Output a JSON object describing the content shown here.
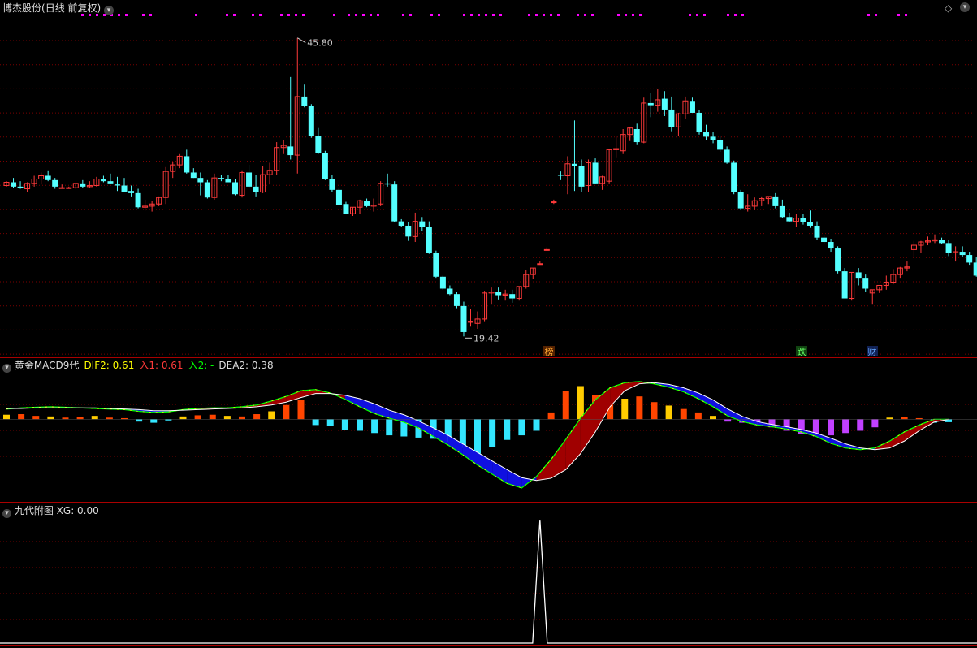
{
  "colors": {
    "up": "#ff3a3a",
    "down": "#54ffff",
    "grid": "#7a0000",
    "separator": "#aa0000",
    "magenta": "#ff00ff",
    "text": "#dddddd",
    "yellow": "#ffff00",
    "green": "#00ff00",
    "white": "#ffffff",
    "blue": "#1010e0",
    "darkred": "#a00000",
    "orange": "#ff4500",
    "gold": "#ffcc00",
    "purple": "#c040ff",
    "cyan": "#33e6ff"
  },
  "header": {
    "title": "博杰股份",
    "period": "(日线 前复权)",
    "dropdown_icon": "chevron-down-icon",
    "right_icon": "diamond-icon"
  },
  "chart_data": [
    {
      "type": "candlestick",
      "title": "博杰股份 (日线 前复权)",
      "ylim": [
        17.5,
        47.8
      ],
      "high_label": "45.80",
      "low_label": "19.42",
      "markers": [
        "榜",
        "跌",
        "财"
      ],
      "candles": [
        [
          32.2,
          32.6,
          32.1,
          32.5
        ],
        [
          32.5,
          32.9,
          32.0,
          32.1
        ],
        [
          32.1,
          32.6,
          31.9,
          32.0
        ],
        [
          31.9,
          32.5,
          31.6,
          32.4
        ],
        [
          32.4,
          33.1,
          32.1,
          32.8
        ],
        [
          32.8,
          33.4,
          32.3,
          33.1
        ],
        [
          33.1,
          33.6,
          32.6,
          32.7
        ],
        [
          32.7,
          32.9,
          31.9,
          32.1
        ],
        [
          32.0,
          32.3,
          31.9,
          32.0
        ],
        [
          32.0,
          32.1,
          31.9,
          32.0
        ],
        [
          32.0,
          32.4,
          31.9,
          32.4
        ],
        [
          32.4,
          32.7,
          32.0,
          32.1
        ],
        [
          32.1,
          32.6,
          32.0,
          32.2
        ],
        [
          32.2,
          33.0,
          32.1,
          32.8
        ],
        [
          32.8,
          33.1,
          32.5,
          32.6
        ],
        [
          32.6,
          33.3,
          32.4,
          32.4
        ],
        [
          32.3,
          33.0,
          31.7,
          32.2
        ],
        [
          32.2,
          32.9,
          31.8,
          31.6
        ],
        [
          31.7,
          32.2,
          31.2,
          31.5
        ],
        [
          31.5,
          31.9,
          30.1,
          30.2
        ],
        [
          30.2,
          30.9,
          29.9,
          30.3
        ],
        [
          30.3,
          30.8,
          29.8,
          30.5
        ],
        [
          30.5,
          31.2,
          30.3,
          31.1
        ],
        [
          31.1,
          33.9,
          30.5,
          33.5
        ],
        [
          33.5,
          34.4,
          32.9,
          34.1
        ],
        [
          34.1,
          35.1,
          33.8,
          34.9
        ],
        [
          34.9,
          35.5,
          33.3,
          33.4
        ],
        [
          33.4,
          33.8,
          32.9,
          32.9
        ],
        [
          32.9,
          33.4,
          31.3,
          32.5
        ],
        [
          32.5,
          32.7,
          31.0,
          31.1
        ],
        [
          31.1,
          33.3,
          30.9,
          32.9
        ],
        [
          32.9,
          33.2,
          32.6,
          32.8
        ],
        [
          32.8,
          33.2,
          32.5,
          32.5
        ],
        [
          32.5,
          32.8,
          31.3,
          31.4
        ],
        [
          31.3,
          33.6,
          31.1,
          33.4
        ],
        [
          33.4,
          34.1,
          32.0,
          32.1
        ],
        [
          32.1,
          33.2,
          31.2,
          31.6
        ],
        [
          31.6,
          34.0,
          31.5,
          33.2
        ],
        [
          33.2,
          34.3,
          32.3,
          33.6
        ],
        [
          33.6,
          36.2,
          33.2,
          35.7
        ],
        [
          35.7,
          36.4,
          35.1,
          35.9
        ],
        [
          35.8,
          42.2,
          34.6,
          35.0
        ],
        [
          35.0,
          45.8,
          33.3,
          40.4
        ],
        [
          40.4,
          41.5,
          39.4,
          39.5
        ],
        [
          39.5,
          39.7,
          36.6,
          36.8
        ],
        [
          36.8,
          37.5,
          35.1,
          35.2
        ],
        [
          35.2,
          35.4,
          32.7,
          32.8
        ],
        [
          32.8,
          33.2,
          31.6,
          31.8
        ],
        [
          31.8,
          32.0,
          30.5,
          30.4
        ],
        [
          30.5,
          30.7,
          29.6,
          29.6
        ],
        [
          29.6,
          30.2,
          29.4,
          30.2
        ],
        [
          30.2,
          30.9,
          29.6,
          30.8
        ],
        [
          30.8,
          31.0,
          30.2,
          30.3
        ],
        [
          30.3,
          31.0,
          29.8,
          30.4
        ],
        [
          30.5,
          32.6,
          30.3,
          32.4
        ],
        [
          32.4,
          33.3,
          32.1,
          32.3
        ],
        [
          32.3,
          32.6,
          28.8,
          28.9
        ],
        [
          28.9,
          29.1,
          28.4,
          28.5
        ],
        [
          28.5,
          28.8,
          27.1,
          27.5
        ],
        [
          27.5,
          29.7,
          27.0,
          28.9
        ],
        [
          28.9,
          29.3,
          28.0,
          28.4
        ],
        [
          28.4,
          28.9,
          25.9,
          26.0
        ],
        [
          26.0,
          26.2,
          23.7,
          23.8
        ],
        [
          23.8,
          23.9,
          22.6,
          22.7
        ],
        [
          22.7,
          23.0,
          22.1,
          22.2
        ],
        [
          22.2,
          22.4,
          20.9,
          21.1
        ],
        [
          21.1,
          21.5,
          18.3,
          18.7
        ],
        [
          19.6,
          20.8,
          19.2,
          19.7
        ],
        [
          19.5,
          20.6,
          19.0,
          19.9
        ],
        [
          19.9,
          22.5,
          19.7,
          22.3
        ],
        [
          22.3,
          22.8,
          21.3,
          22.4
        ],
        [
          22.4,
          22.8,
          21.7,
          22.1
        ],
        [
          22.1,
          22.6,
          21.6,
          22.2
        ],
        [
          22.2,
          22.6,
          21.4,
          21.8
        ],
        [
          21.8,
          22.9,
          21.6,
          22.9
        ],
        [
          22.9,
          24.4,
          22.7,
          24.0
        ],
        [
          24.0,
          24.6,
          23.6,
          24.6
        ],
        [
          25.0,
          25.2,
          24.9,
          25.0
        ],
        [
          26.3,
          26.5,
          26.2,
          26.3
        ],
        [
          30.7,
          30.9,
          30.5,
          30.7
        ],
        [
          33.2,
          33.5,
          32.7,
          33.1
        ],
        [
          33.1,
          34.9,
          31.4,
          34.2
        ],
        [
          34.2,
          38.2,
          31.7,
          34.0
        ],
        [
          34.0,
          34.6,
          31.6,
          32.1
        ],
        [
          32.2,
          34.6,
          31.6,
          34.3
        ],
        [
          34.3,
          34.7,
          32.4,
          32.4
        ],
        [
          32.4,
          33.1,
          31.8,
          33.0
        ],
        [
          32.6,
          35.6,
          32.4,
          35.5
        ],
        [
          35.5,
          36.8,
          34.8,
          35.6
        ],
        [
          35.4,
          37.4,
          35.1,
          36.9
        ],
        [
          36.9,
          37.6,
          36.3,
          37.5
        ],
        [
          37.4,
          37.9,
          36.0,
          36.2
        ],
        [
          36.2,
          40.3,
          36.1,
          39.8
        ],
        [
          39.8,
          40.7,
          38.5,
          39.6
        ],
        [
          39.6,
          41.1,
          39.0,
          40.1
        ],
        [
          40.2,
          40.9,
          38.6,
          39.2
        ],
        [
          39.2,
          40.4,
          37.2,
          37.6
        ],
        [
          37.6,
          38.9,
          36.8,
          38.8
        ],
        [
          38.8,
          40.4,
          38.3,
          40.0
        ],
        [
          40.0,
          40.3,
          38.9,
          38.9
        ],
        [
          38.9,
          39.2,
          36.9,
          37.1
        ],
        [
          37.1,
          37.8,
          36.4,
          36.7
        ],
        [
          36.7,
          37.1,
          36.1,
          36.4
        ],
        [
          36.4,
          36.8,
          35.3,
          35.5
        ],
        [
          35.5,
          35.8,
          34.2,
          34.3
        ],
        [
          34.3,
          34.5,
          31.4,
          31.6
        ],
        [
          31.6,
          31.8,
          30.0,
          30.1
        ],
        [
          30.1,
          31.4,
          29.8,
          30.3
        ],
        [
          30.3,
          31.1,
          30.0,
          30.8
        ],
        [
          30.8,
          31.2,
          30.3,
          31.0
        ],
        [
          31.0,
          31.2,
          30.5,
          31.2
        ],
        [
          31.2,
          31.5,
          30.1,
          30.3
        ],
        [
          30.3,
          30.9,
          29.2,
          29.3
        ],
        [
          29.3,
          29.7,
          28.8,
          28.9
        ],
        [
          28.9,
          29.6,
          28.4,
          29.2
        ],
        [
          29.2,
          29.6,
          28.6,
          28.8
        ],
        [
          28.8,
          29.9,
          28.3,
          28.5
        ],
        [
          28.5,
          28.9,
          27.2,
          27.4
        ],
        [
          27.4,
          27.6,
          26.8,
          27.0
        ],
        [
          27.0,
          27.3,
          26.1,
          26.4
        ],
        [
          26.4,
          26.6,
          24.1,
          24.3
        ],
        [
          24.3,
          24.6,
          21.8,
          21.8
        ],
        [
          21.8,
          24.2,
          21.6,
          24.2
        ],
        [
          24.2,
          24.6,
          23.0,
          23.7
        ],
        [
          23.7,
          24.0,
          22.4,
          22.7
        ],
        [
          22.3,
          22.6,
          21.3,
          22.6
        ],
        [
          22.6,
          22.8,
          22.3,
          23.0
        ],
        [
          23.0,
          23.9,
          22.6,
          23.3
        ],
        [
          23.3,
          24.5,
          23.1,
          24.0
        ],
        [
          24.0,
          24.7,
          23.7,
          24.6
        ],
        [
          24.6,
          25.2,
          24.3,
          24.7
        ],
        [
          26.3,
          27.1,
          25.6,
          26.7
        ],
        [
          26.7,
          27.1,
          26.0,
          27.0
        ],
        [
          27.0,
          27.5,
          26.7,
          27.1
        ],
        [
          27.1,
          27.7,
          26.9,
          27.2
        ],
        [
          27.2,
          27.4,
          26.8,
          26.9
        ],
        [
          26.9,
          27.2,
          25.7,
          26.0
        ],
        [
          26.0,
          26.6,
          25.2,
          26.1
        ],
        [
          26.1,
          26.6,
          25.6,
          25.8
        ],
        [
          25.8,
          26.1,
          24.9,
          25.1
        ],
        [
          25.1,
          25.6,
          23.8,
          23.9
        ],
        [
          23.9,
          25.0,
          23.6,
          24.7
        ],
        [
          24.7,
          25.2,
          24.0,
          24.0
        ]
      ]
    },
    {
      "type": "macd",
      "title": "黄金MACD9代",
      "ylim": [
        -1.4,
        0.8
      ],
      "dif": [
        0.18,
        0.2,
        0.21,
        0.22,
        0.21,
        0.2,
        0.19,
        0.18,
        0.17,
        0.14,
        0.12,
        0.13,
        0.17,
        0.19,
        0.2,
        0.2,
        0.22,
        0.25,
        0.32,
        0.4,
        0.5,
        0.52,
        0.46,
        0.35,
        0.22,
        0.1,
        0.02,
        -0.05,
        -0.15,
        -0.3,
        -0.45,
        -0.62,
        -0.8,
        -0.96,
        -1.12,
        -1.2,
        -1.0,
        -0.7,
        -0.35,
        0.02,
        0.34,
        0.55,
        0.64,
        0.66,
        0.62,
        0.56,
        0.48,
        0.36,
        0.22,
        0.06,
        -0.04,
        -0.1,
        -0.13,
        -0.17,
        -0.22,
        -0.3,
        -0.42,
        -0.5,
        -0.53,
        -0.5,
        -0.38,
        -0.22,
        -0.1,
        0.0,
        0.0
      ],
      "dea": [
        0.19,
        0.19,
        0.2,
        0.2,
        0.2,
        0.2,
        0.2,
        0.19,
        0.18,
        0.17,
        0.15,
        0.15,
        0.16,
        0.17,
        0.18,
        0.19,
        0.2,
        0.22,
        0.25,
        0.3,
        0.38,
        0.45,
        0.45,
        0.42,
        0.36,
        0.27,
        0.16,
        0.08,
        -0.03,
        -0.15,
        -0.28,
        -0.43,
        -0.58,
        -0.73,
        -0.88,
        -1.02,
        -1.07,
        -1.03,
        -0.88,
        -0.6,
        -0.22,
        0.22,
        0.5,
        0.62,
        0.64,
        0.61,
        0.55,
        0.46,
        0.34,
        0.18,
        0.05,
        -0.04,
        -0.09,
        -0.13,
        -0.18,
        -0.24,
        -0.33,
        -0.43,
        -0.5,
        -0.53,
        -0.5,
        -0.38,
        -0.2,
        -0.05,
        0.0
      ],
      "bars": [
        0.08,
        0.09,
        0.06,
        0.05,
        0.03,
        0.04,
        0.06,
        0.03,
        0.02,
        -0.04,
        -0.06,
        -0.02,
        0.05,
        0.07,
        0.08,
        0.06,
        0.05,
        0.09,
        0.14,
        0.25,
        0.34,
        -0.1,
        -0.12,
        -0.18,
        -0.2,
        -0.24,
        -0.28,
        -0.3,
        -0.32,
        -0.34,
        -0.4,
        -0.5,
        -0.6,
        -0.48,
        -0.36,
        -0.28,
        -0.2,
        0.12,
        0.5,
        0.58,
        0.42,
        0.3,
        0.36,
        0.4,
        0.3,
        0.24,
        0.18,
        0.12,
        0.06,
        -0.04,
        -0.06,
        -0.1,
        -0.14,
        -0.2,
        -0.26,
        -0.3,
        -0.28,
        -0.24,
        -0.2,
        -0.14,
        0.03,
        0.04,
        0.02,
        -0.06,
        -0.05
      ],
      "labels": [
        {
          "text": "黄金MACD9代",
          "color": "#dddddd"
        },
        {
          "text": "DIF2: 0.61",
          "color": "#ffff00"
        },
        {
          "text": "入1: 0.61",
          "color": "#ff3a3a"
        },
        {
          "text": "入2: -",
          "color": "#00ff00"
        },
        {
          "text": "DEA2: 0.38",
          "color": "#dddddd"
        }
      ]
    },
    {
      "type": "line",
      "title": "九代附图",
      "series_label": "XG: 0.00",
      "ylim": [
        0,
        1
      ],
      "spike_index": 77,
      "values_note": "zero everywhere except a single spike of 1 at spike_index"
    }
  ],
  "top_dot_groups": [
    "dots"
  ],
  "icons": [
    "chevron-down-icon",
    "chevron-down-icon",
    "chevron-down-icon",
    "diamond-icon"
  ]
}
